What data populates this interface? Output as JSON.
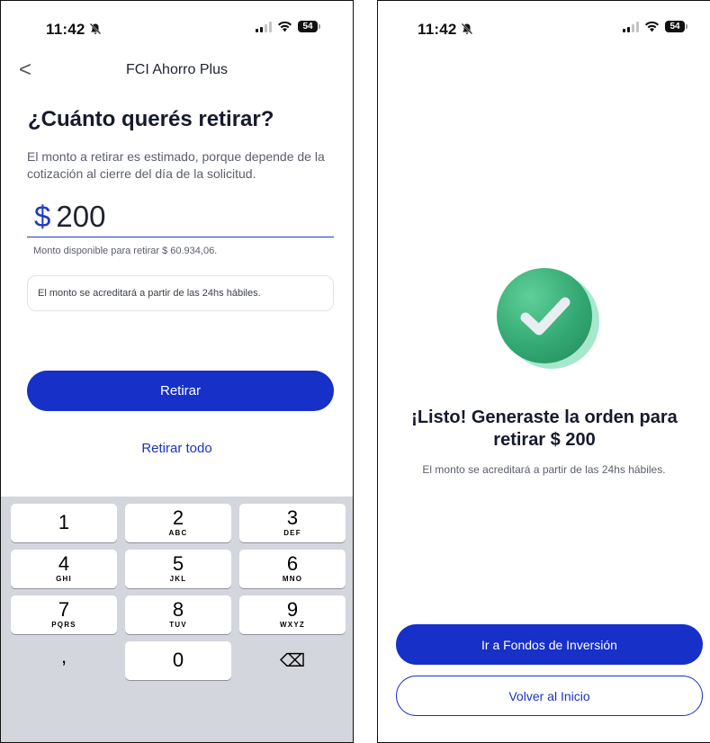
{
  "left": {
    "status": {
      "time": "11:42",
      "battery": "54"
    },
    "nav": {
      "back": "<",
      "title": "FCI Ahorro Plus"
    },
    "heading": "¿Cuánto querés retirar?",
    "description": "El monto a retirar es estimado, porque depende de la cotización al cierre del día de la solicitud.",
    "amount": {
      "currency": "$",
      "value": "200"
    },
    "available": "Monto disponible para retirar $ 60.934,06.",
    "info": "El monto se acreditará a partir de las 24hs hábiles.",
    "primary_button": "Retirar",
    "link_button": "Retirar todo",
    "keypad": [
      {
        "num": "1",
        "letters": ""
      },
      {
        "num": "2",
        "letters": "ABC"
      },
      {
        "num": "3",
        "letters": "DEF"
      },
      {
        "num": "4",
        "letters": "GHI"
      },
      {
        "num": "5",
        "letters": "JKL"
      },
      {
        "num": "6",
        "letters": "MNO"
      },
      {
        "num": "7",
        "letters": "PQRS"
      },
      {
        "num": "8",
        "letters": "TUV"
      },
      {
        "num": "9",
        "letters": "WXYZ"
      },
      {
        "num": "0",
        "letters": ""
      }
    ],
    "comma": ",",
    "backspace": "⌫"
  },
  "right": {
    "status": {
      "time": "11:42",
      "battery": "54"
    },
    "title": "¡Listo! Generaste la orden para retirar $ 200",
    "subtitle": "El monto se acreditará a partir de las 24hs hábiles.",
    "primary_button": "Ir a Fondos de Inversión",
    "secondary_button": "Volver al Inicio"
  },
  "colors": {
    "primary": "#1630c8",
    "success": "#33a872",
    "keyboard": "#d4d6dd"
  }
}
